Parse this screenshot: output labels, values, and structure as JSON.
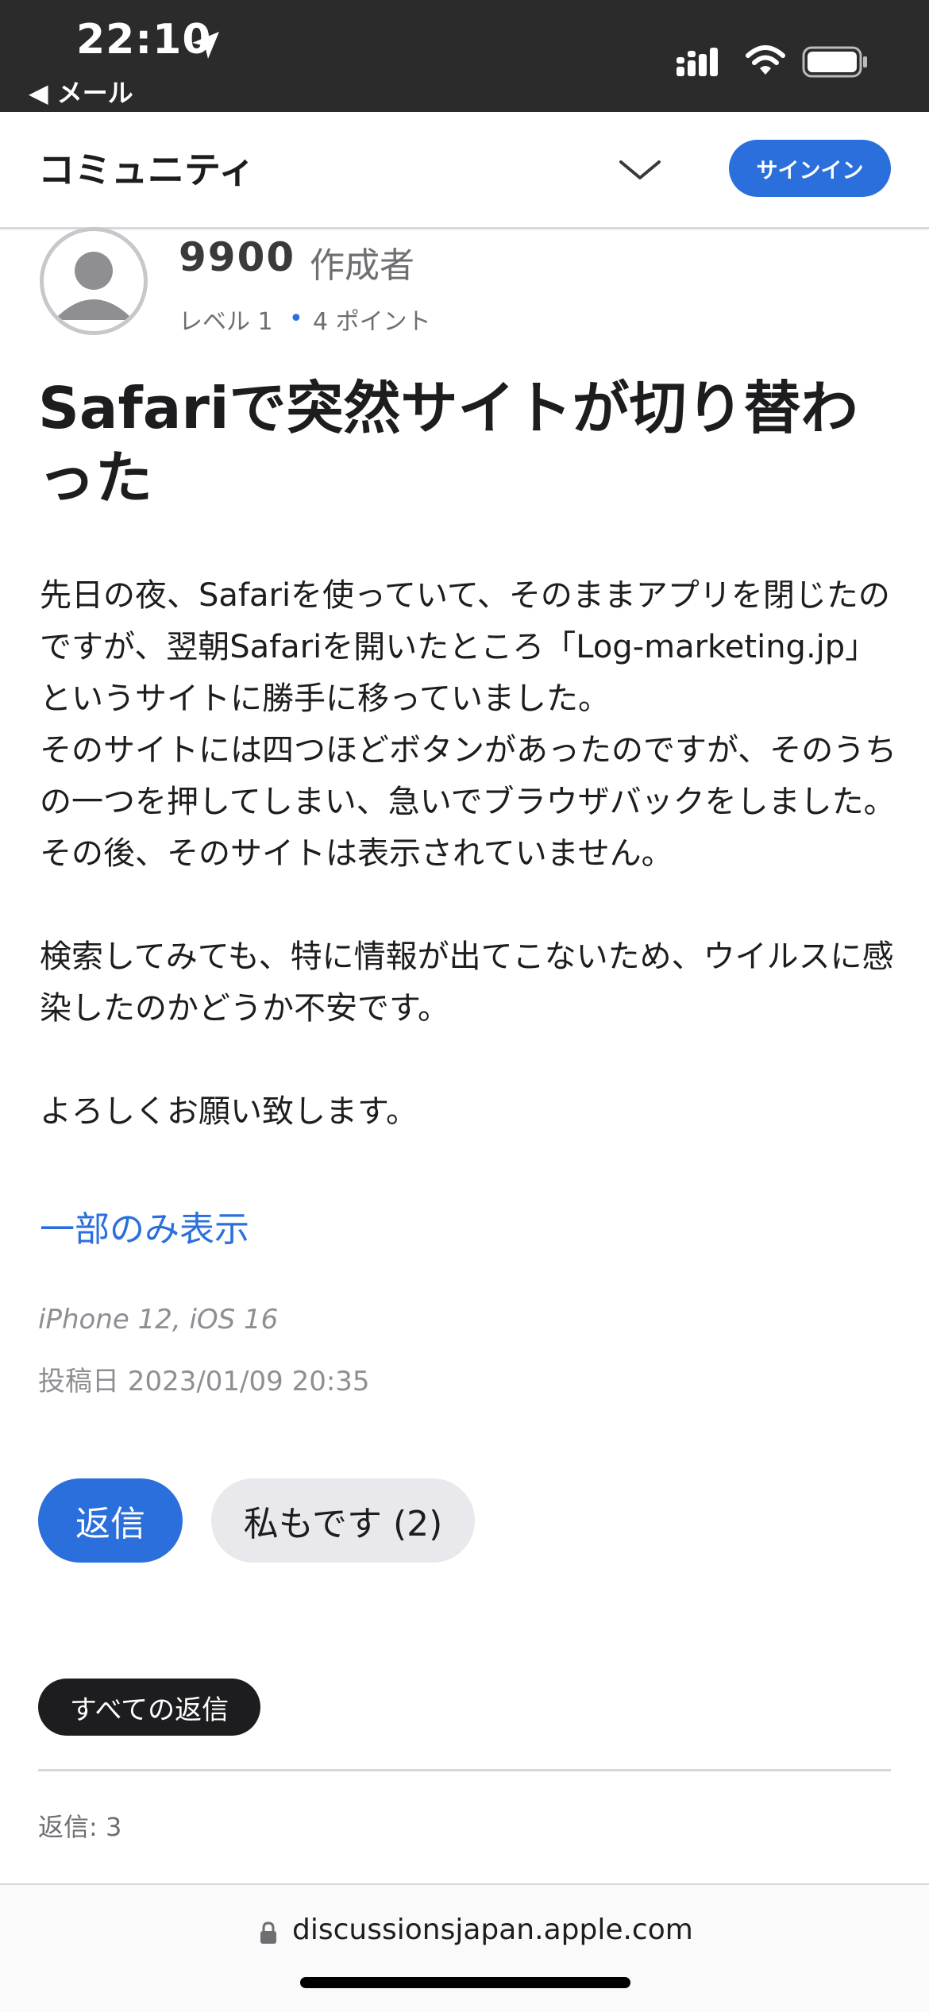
{
  "status_bar": {
    "time": "22:10",
    "back_label": "◀ メール",
    "icons": [
      "location-arrow-icon",
      "cellular-signal-icon",
      "wifi-icon",
      "battery-icon"
    ]
  },
  "nav": {
    "title": "コミュニティ",
    "signin_label": "サインイン",
    "menu_icon": "chevron-down-icon"
  },
  "author": {
    "name": "9900",
    "role": "作成者",
    "level": "レベル 1",
    "separator": "•",
    "points": "4 ポイント"
  },
  "post": {
    "title": "Safariで突然サイトが切り替わった",
    "body": "先日の夜、Safariを使っていて、そのままアプリを閉じたのですが、翌朝Safariを開いたところ「Log-marketing.jp」というサイトに勝手に移っていました。\nそのサイトには四つほどボタンがあったのですが、そのうちの一つを押してしまい、急いでブラウザバックをしました。\nその後、そのサイトは表示されていません。\n\n検索してみても、特に情報が出てこないため、ウイルスに感染したのかどうか不安です。\n\nよろしくお願い致します。",
    "show_less": "一部のみ表示",
    "device": "iPhone 12, iOS 16",
    "posted_date": "投稿日 2023/01/09 20:35"
  },
  "actions": {
    "reply_label": "返信",
    "metoo_label": "私もです (2)"
  },
  "replies": {
    "filter_label": "すべての返信",
    "count_label": "返信: 3"
  },
  "browser": {
    "url": "discussionsjapan.apple.com"
  },
  "colors": {
    "accent": "#2a6fdb",
    "status_bar_bg": "#2b2b2b",
    "text": "#1d1d1f",
    "secondary": "#6e6e73"
  }
}
